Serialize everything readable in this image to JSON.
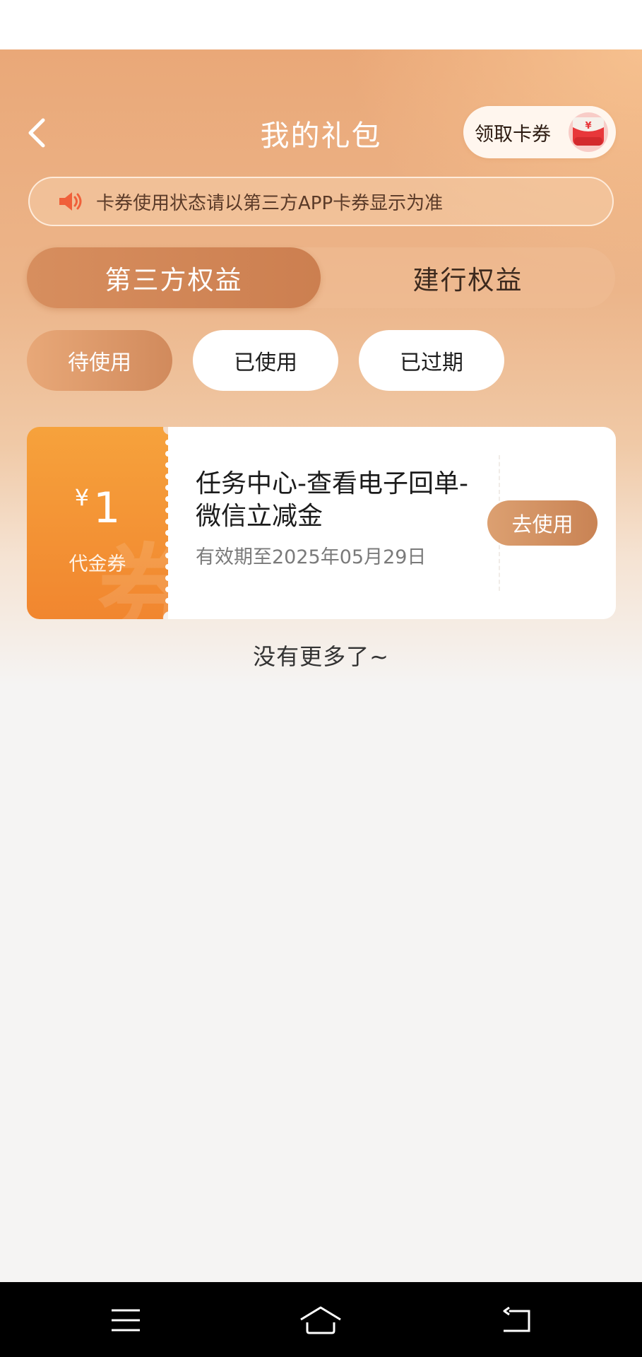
{
  "header": {
    "title": "我的礼包",
    "claim_label": "领取卡券",
    "claim_icon_symbol": "¥",
    "back_icon": "chevron-left-icon"
  },
  "notice": {
    "text": "卡券使用状态请以第三方APP卡券显示为准",
    "icon": "speaker-icon"
  },
  "main_tabs": [
    {
      "label": "第三方权益",
      "active": true
    },
    {
      "label": "建行权益",
      "active": false
    }
  ],
  "sub_tabs": [
    {
      "label": "待使用",
      "active": true
    },
    {
      "label": "已使用",
      "active": false
    },
    {
      "label": "已过期",
      "active": false
    }
  ],
  "coupons": [
    {
      "currency": "¥",
      "amount": "1",
      "type": "代金券",
      "watermark": "券",
      "title": "任务中心-查看电子回单-微信立减金",
      "expiry": "有效期至2025年05月29日",
      "action": "去使用"
    }
  ],
  "footer_text": "没有更多了~",
  "nav": {
    "menu_icon": "menu-icon",
    "home_icon": "home-icon",
    "back_icon": "back-icon"
  },
  "colors": {
    "accent": "#cc7f50",
    "coupon_orange": "#f6a23c",
    "notice_speaker": "#f0603a"
  }
}
